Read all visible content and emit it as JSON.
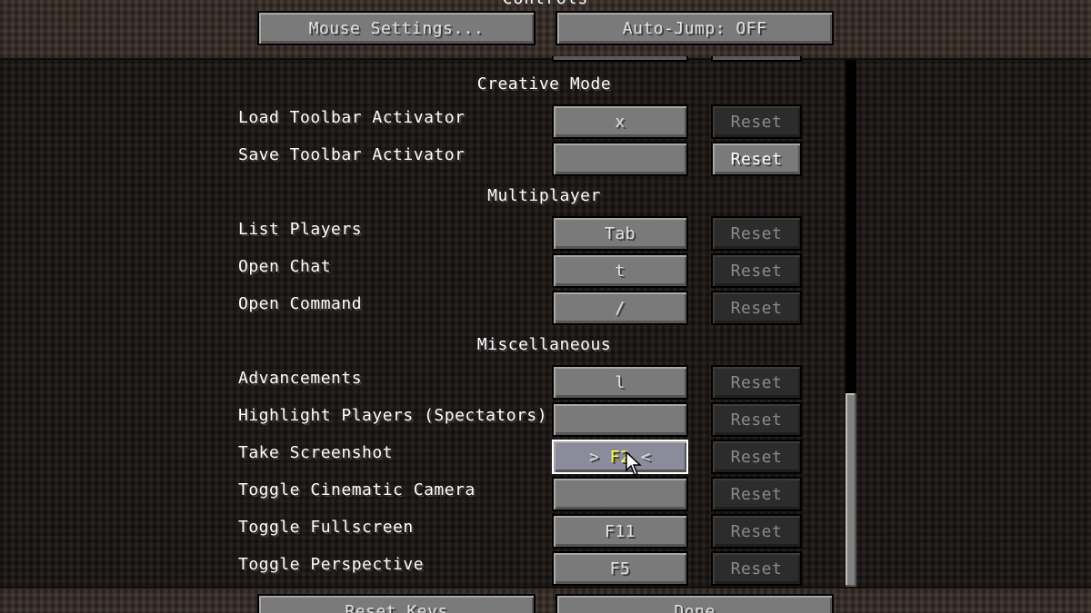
{
  "screen": {
    "title": "Controls"
  },
  "top_buttons": {
    "mouse_settings": "Mouse Settings...",
    "auto_jump": "Auto-Jump: OFF"
  },
  "bottom_buttons": {
    "reset_keys": "Reset Keys",
    "done": "Done"
  },
  "categories": {
    "creative": "Creative Mode",
    "multiplayer": "Multiplayer",
    "misc": "Miscellaneous"
  },
  "reset_label": "Reset",
  "bindings": [
    {
      "label": "Load Toolbar Activator",
      "key": "x",
      "reset_enabled": false
    },
    {
      "label": "Save Toolbar Activator",
      "key": "",
      "reset_enabled": true
    },
    {
      "label": "List Players",
      "key": "Tab",
      "reset_enabled": false
    },
    {
      "label": "Open Chat",
      "key": "t",
      "reset_enabled": false
    },
    {
      "label": "Open Command",
      "key": "/",
      "reset_enabled": false
    },
    {
      "label": "Advancements",
      "key": "l",
      "reset_enabled": false
    },
    {
      "label": "Highlight Players (Spectators)",
      "key": "",
      "reset_enabled": false
    },
    {
      "label": "Take Screenshot",
      "key_prefix": ">",
      "key": "F2",
      "key_suffix": "<",
      "reset_enabled": false,
      "selected": true
    },
    {
      "label": "Toggle Cinematic Camera",
      "key": "",
      "reset_enabled": false
    },
    {
      "label": "Toggle Fullscreen",
      "key": "F11",
      "reset_enabled": false
    },
    {
      "label": "Toggle Perspective",
      "key": "F5",
      "reset_enabled": false
    }
  ],
  "colors": {
    "selected_key_text": "#ffff55",
    "text": "#ffffff",
    "disabled_text": "#8a8a8a"
  }
}
